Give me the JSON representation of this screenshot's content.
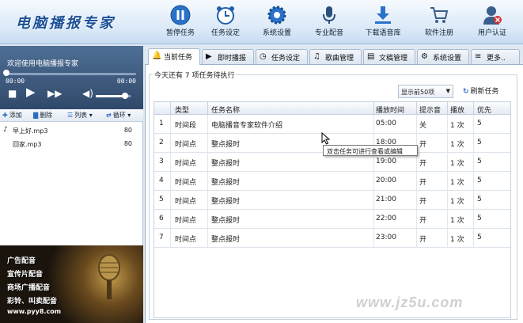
{
  "app": {
    "title": "电脑播报专家"
  },
  "toolbar": {
    "items": [
      {
        "label": "暂停任务",
        "icon": "pause-icon"
      },
      {
        "label": "任务设定",
        "icon": "alarm-clock-icon"
      },
      {
        "label": "系统设置",
        "icon": "gear-icon"
      },
      {
        "label": "专业配音",
        "icon": "microphone-icon"
      },
      {
        "label": "下载语音库",
        "icon": "download-icon"
      },
      {
        "label": "软件注册",
        "icon": "cart-icon"
      },
      {
        "label": "用户认证",
        "icon": "user-icon"
      }
    ]
  },
  "player": {
    "welcome": "欢迎使用电脑播报专家",
    "time_elapsed": "00:00",
    "time_total": "00:00",
    "volume_level": 0.75
  },
  "playlist_toolbar": {
    "add": "添加",
    "delete": "删除",
    "list": "列表",
    "loop": "循环"
  },
  "playlist": [
    {
      "name": "早上好.mp3",
      "value": "80"
    },
    {
      "name": "回家.mp3",
      "value": "80"
    }
  ],
  "ad": {
    "lines": [
      "广告配音",
      "宣传片配音",
      "商场广播配音",
      "彩铃、叫卖配音"
    ],
    "url": "www.pyy8.com"
  },
  "tabs": [
    {
      "label": "当前任务",
      "icon": "bell-icon",
      "active": true
    },
    {
      "label": "即时播报",
      "icon": "play-icon",
      "active": false
    },
    {
      "label": "任务设定",
      "icon": "clock-icon",
      "active": false
    },
    {
      "label": "歌曲管理",
      "icon": "music-icon",
      "active": false
    },
    {
      "label": "文稿管理",
      "icon": "document-icon",
      "active": false
    },
    {
      "label": "系统设置",
      "icon": "gear-icon",
      "active": false
    },
    {
      "label": "更多..",
      "icon": "more-icon",
      "active": false
    }
  ],
  "task_panel": {
    "title": "今天还有 7 项任务待执行",
    "filter": "显示前50项",
    "refresh": "刷新任务"
  },
  "table": {
    "columns": [
      "类型",
      "任务名称",
      "播放时间",
      "提示音",
      "播放",
      "优先"
    ],
    "rows": [
      {
        "no": "1",
        "type": "时间段",
        "name": "电脑播音专家软件介绍",
        "time": "05:00",
        "tone": "关",
        "play": "1 次",
        "priority": "5"
      },
      {
        "no": "2",
        "type": "时间点",
        "name": "整点报时",
        "time": "18:00",
        "tone": "开",
        "play": "1 次",
        "priority": "5"
      },
      {
        "no": "3",
        "type": "时间点",
        "name": "整点报时",
        "time": "19:00",
        "tone": "开",
        "play": "1 次",
        "priority": "5"
      },
      {
        "no": "4",
        "type": "时间点",
        "name": "整点报时",
        "time": "20:00",
        "tone": "开",
        "play": "1 次",
        "priority": "5"
      },
      {
        "no": "5",
        "type": "时间点",
        "name": "整点报时",
        "time": "21:00",
        "tone": "开",
        "play": "1 次",
        "priority": "5"
      },
      {
        "no": "6",
        "type": "时间点",
        "name": "整点报时",
        "time": "22:00",
        "tone": "开",
        "play": "1 次",
        "priority": "5"
      },
      {
        "no": "7",
        "type": "时间点",
        "name": "整点报时",
        "time": "23:00",
        "tone": "开",
        "play": "1 次",
        "priority": "5"
      }
    ]
  },
  "tooltip": "双击任务可进行查看或编辑",
  "watermark": "www.jz5u.com",
  "colors": {
    "accent": "#2b6bc2",
    "player_bg": "#3c587c",
    "header_bg": "#d9e8f7"
  }
}
